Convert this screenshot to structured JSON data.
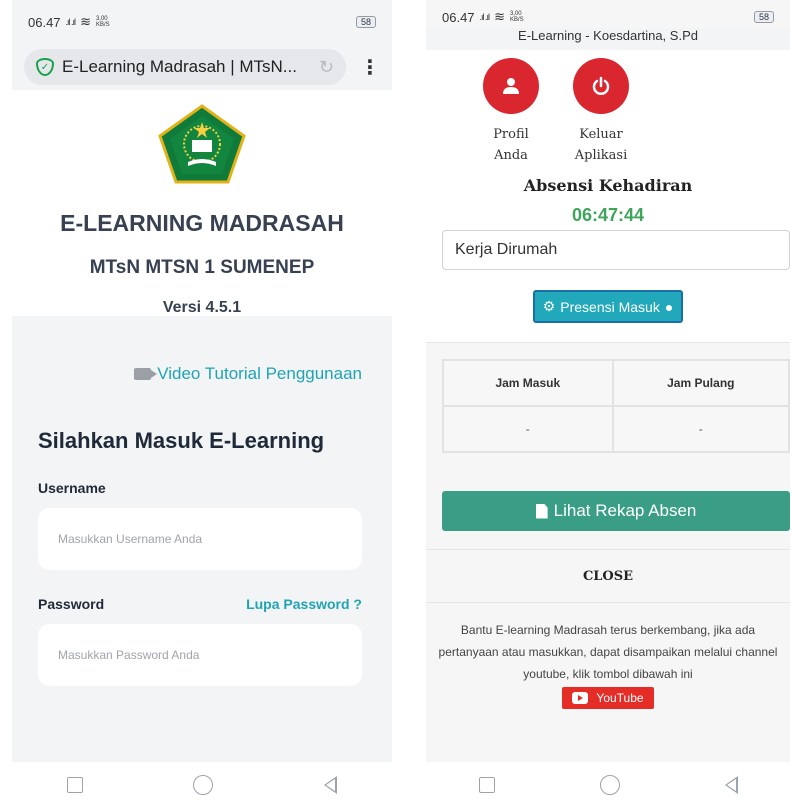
{
  "left": {
    "status": {
      "time": "06.47",
      "signal": ".ıl .ıl",
      "wifi": "≋",
      "speed_top": "3,00",
      "speed_unit": "KB/S",
      "battery": "58"
    },
    "browser": {
      "url_title": "E-Learning Madrasah | MTsN...",
      "reload_icon": "reload-icon",
      "menu_icon": "kebab-icon"
    },
    "header": {
      "app_title": "E-LEARNING MADRASAH",
      "school": "MTsN MTSN 1 SUMENEP",
      "version": "Versi 4.5.1"
    },
    "video_link": "Video Tutorial Penggunaan",
    "login": {
      "title": "Silahkan Masuk E-Learning",
      "username_label": "Username",
      "username_placeholder": "Masukkan Username Anda",
      "password_label": "Password",
      "forgot": "Lupa Password ?",
      "password_placeholder": "Masukkan Password Anda"
    }
  },
  "right": {
    "status": {
      "time": "06.47",
      "signal": ".ıl .ıl",
      "wifi": "≋",
      "speed_top": "3,00",
      "speed_unit": "KB/S",
      "battery": "58"
    },
    "header_title": "E-Learning - Koesdartina, S.Pd",
    "profile": {
      "line1": "Profil",
      "line2": "Anda"
    },
    "logout": {
      "line1": "Keluar",
      "line2": "Aplikasi"
    },
    "absensi_title": "Absensi Kehadiran",
    "clock": "06:47:44",
    "mode_select": "Kerja Dirumah",
    "presensi_button": "Presensi Masuk",
    "table": {
      "headers": [
        "Jam Masuk",
        "Jam Pulang"
      ],
      "values": [
        "-",
        "-"
      ]
    },
    "rekap_button": "Lihat Rekap Absen",
    "close": "CLOSE",
    "info": "Bantu E-learning Madrasah terus berkembang, jika ada pertanyaan atau masukkan, dapat disampaikan melalui channel youtube, klik tombol dibawah ini",
    "youtube_button": "YouTube"
  },
  "colors": {
    "accent_teal": "#20a4b5",
    "danger_red": "#d9262f",
    "clock_green": "#3ea55a",
    "rekap_green": "#3a9e86",
    "youtube_red": "#e52d27"
  }
}
